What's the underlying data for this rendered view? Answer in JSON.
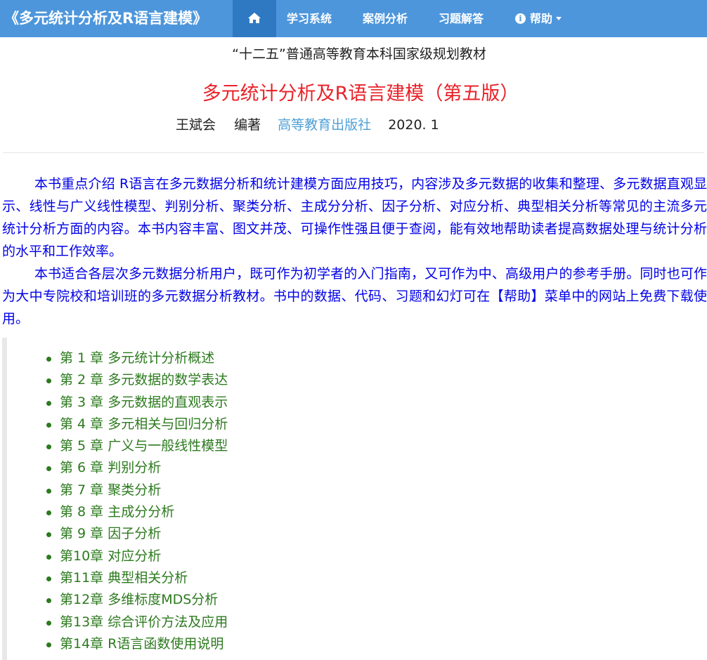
{
  "nav": {
    "brand": "《多元统计分析及R语言建模》",
    "home_icon": "home-icon",
    "items": [
      "学习系统",
      "案例分析",
      "习题解答"
    ],
    "help": "帮助",
    "help_icon": "info-circle-icon",
    "color": "#4d96dc"
  },
  "book": {
    "series": "“十二五”普通高等教育本科国家级规划教材",
    "title": "多元统计分析及R语言建模（第五版）",
    "author": "王斌会",
    "role": "编著",
    "publisher": "高等教育出版社",
    "year": "2020. 1"
  },
  "intro": [
    "本书重点介绍 R语言在多元数据分析和统计建模方面应用技巧，内容涉及多元数据的收集和整理、多元数据直观显示、线性与广义线性模型、判别分析、聚类分析、主成分分析、因子分析、对应分析、典型相关分析等常见的主流多元统计分析方面的内容。本书内容丰富、图文并茂、可操作性强且便于查阅，能有效地帮助读者提高数据处理与统计分析的水平和工作效率。",
    "本书适合各层次多元数据分析用户，既可作为初学者的入门指南，又可作为中、高级用户的参考手册。同时也可作为大中专院校和培训班的多元数据分析教材。书中的数据、代码、习题和幻灯可在【帮助】菜单中的网站上免费下载使用。"
  ],
  "chapters": [
    "第 1 章 多元统计分析概述",
    "第 2 章 多元数据的数学表达",
    "第 3 章 多元数据的直观表示",
    "第 4 章 多元相关与回归分析",
    "第 5 章 广义与一般线性模型",
    "第 6 章 判别分析",
    "第 7 章 聚类分析",
    "第 8 章 主成分分析",
    "第 9 章 因子分析",
    "第10章 对应分析",
    "第11章 典型相关分析",
    "第12章 多维标度MDS分析",
    "第13章 综合评价方法及应用",
    "第14章 R语言函数使用说明"
  ]
}
